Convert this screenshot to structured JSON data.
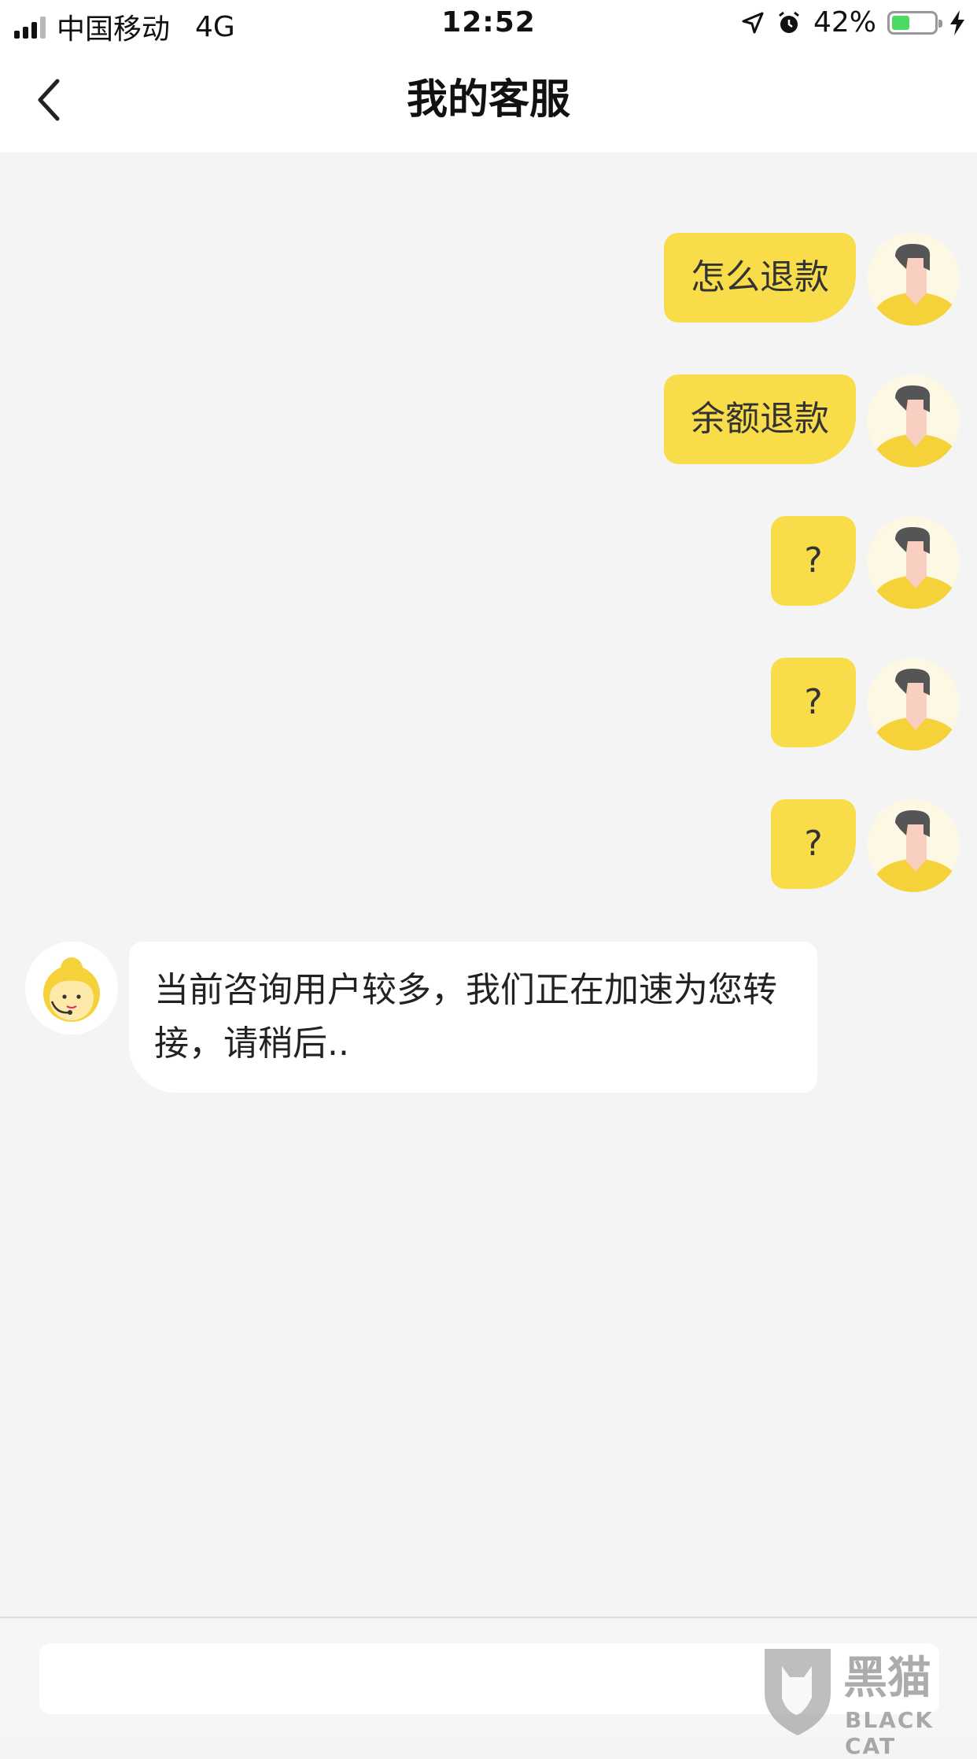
{
  "status": {
    "carrier": "中国移动",
    "network": "4G",
    "time": "12:52",
    "battery": "42%",
    "battery_level": 0.42
  },
  "header": {
    "title": "我的客服"
  },
  "messages": {
    "out": [
      "怎么退款",
      "余额退款",
      "?",
      "?",
      "?"
    ],
    "in": [
      "当前咨询用户较多，我们正在加速为您转接，请稍后.."
    ]
  },
  "input": {
    "placeholder": ""
  },
  "watermark": {
    "title": "黑猫",
    "subtitle": "BLACK CAT"
  },
  "colors": {
    "accent": "#f8dc4a",
    "background": "#f4f4f4"
  }
}
